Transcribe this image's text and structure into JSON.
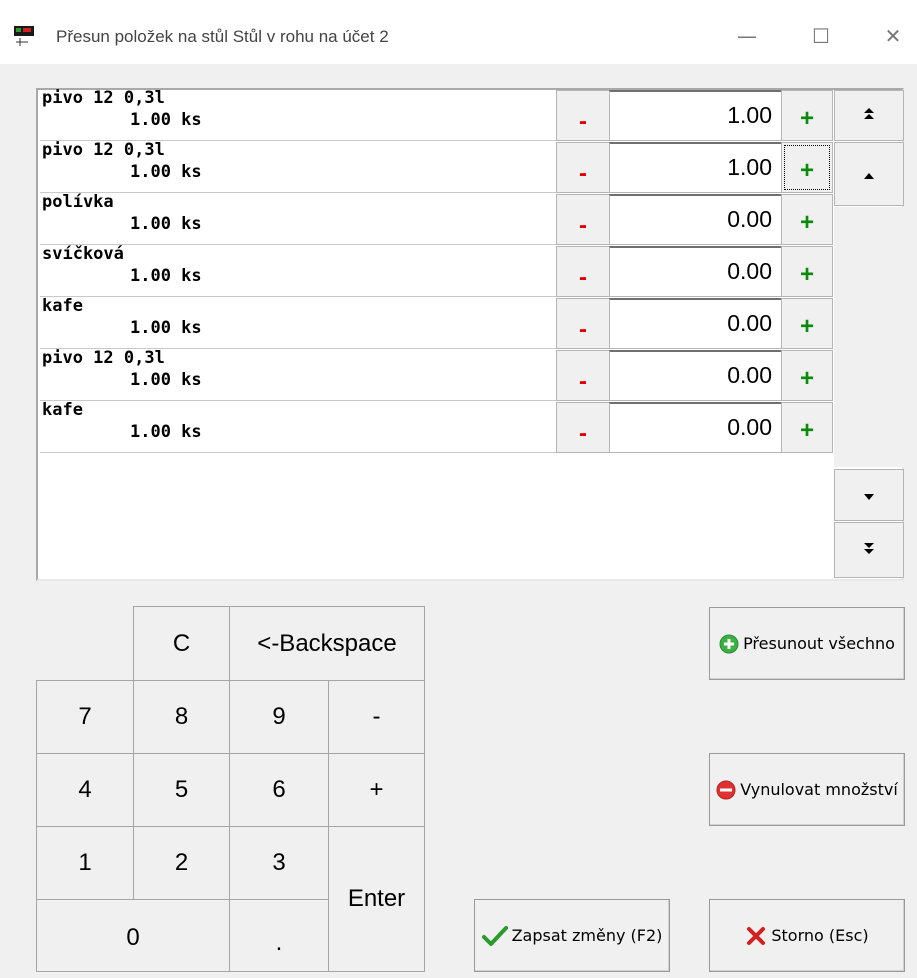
{
  "window": {
    "title": "Přesun položek na stůl Stůl v rohu na účet 2",
    "minimize": "—",
    "maximize": "☐",
    "close": "✕"
  },
  "items": [
    {
      "name": "pivo 12 0,3l",
      "qty": "1.00 ks",
      "minus": "-",
      "value": "1.00",
      "plus": "+"
    },
    {
      "name": "pivo 12 0,3l",
      "qty": "1.00 ks",
      "minus": "-",
      "value": "1.00",
      "plus": "+"
    },
    {
      "name": "polívka",
      "qty": "1.00 ks",
      "minus": "-",
      "value": "0.00",
      "plus": "+"
    },
    {
      "name": "svíčková",
      "qty": "1.00 ks",
      "minus": "-",
      "value": "0.00",
      "plus": "+"
    },
    {
      "name": "kafe",
      "qty": "1.00 ks",
      "minus": "-",
      "value": "0.00",
      "plus": "+"
    },
    {
      "name": "pivo 12 0,3l",
      "qty": "1.00 ks",
      "minus": "-",
      "value": "0.00",
      "plus": "+"
    },
    {
      "name": "kafe",
      "qty": "1.00 ks",
      "minus": "-",
      "value": "0.00",
      "plus": "+"
    }
  ],
  "scroll": {
    "top": "⇞",
    "up": "▲",
    "down": "▼",
    "bottom": "⇟"
  },
  "keypad": {
    "clear": "C",
    "backspace": "<-Backspace",
    "k7": "7",
    "k8": "8",
    "k9": "9",
    "minus": "-",
    "k4": "4",
    "k5": "5",
    "k6": "6",
    "plus": "+",
    "k1": "1",
    "k2": "2",
    "k3": "3",
    "enter": "Enter",
    "k0": "0",
    "dot": "."
  },
  "actions": {
    "move_all": "Přesunout všechno",
    "reset": "Vynulovat množství",
    "save": "Zapsat změny (F2)",
    "cancel": "Storno (Esc)"
  },
  "colors": {
    "minus": "#e00000",
    "plus": "#0a8a0a",
    "add_icon": "#3cb043",
    "reset_icon": "#e03030",
    "cancel_icon": "#d02020"
  }
}
